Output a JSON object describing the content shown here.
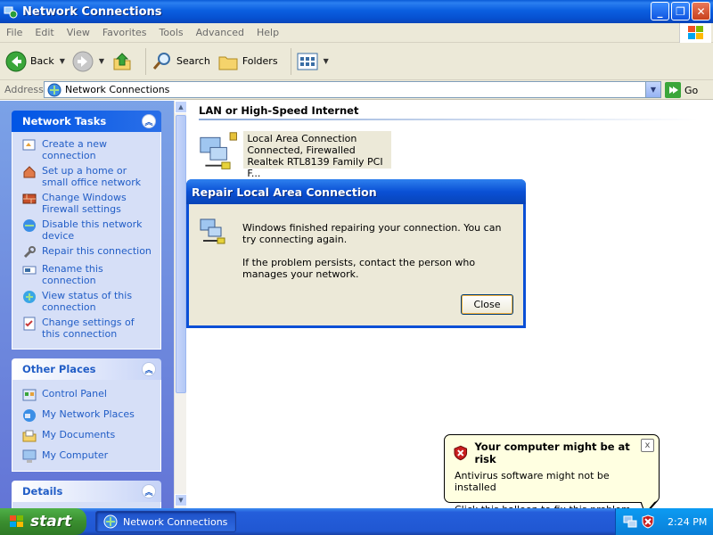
{
  "window": {
    "title": "Network Connections"
  },
  "menu": [
    "File",
    "Edit",
    "View",
    "Favorites",
    "Tools",
    "Advanced",
    "Help"
  ],
  "toolbar": {
    "back": "Back",
    "search": "Search",
    "folders": "Folders"
  },
  "address": {
    "label": "Address",
    "value": "Network Connections",
    "go": "Go"
  },
  "network_tasks": {
    "title": "Network Tasks",
    "items": [
      "Create a new connection",
      "Set up a home or small office network",
      "Change Windows Firewall settings",
      "Disable this network device",
      "Repair this connection",
      "Rename this connection",
      "View status of this connection",
      "Change settings of this connection"
    ]
  },
  "other_places": {
    "title": "Other Places",
    "items": [
      "Control Panel",
      "My Network Places",
      "My Documents",
      "My Computer"
    ]
  },
  "details": {
    "title": "Details"
  },
  "content": {
    "group": "LAN or High-Speed Internet",
    "connection": {
      "name": "Local Area Connection",
      "status": "Connected, Firewalled",
      "device": "Realtek RTL8139 Family PCI F..."
    }
  },
  "dialog": {
    "title": "Repair Local Area Connection",
    "line1": "Windows finished repairing your connection. You can try connecting again.",
    "line2": "If the problem persists, contact the person who manages your network.",
    "close": "Close"
  },
  "balloon": {
    "title": "Your computer might be at risk",
    "line1": "Antivirus software might not be installed",
    "line2": "Click this balloon to fix this problem.",
    "close": "x"
  },
  "taskbar": {
    "start": "start",
    "task": "Network Connections",
    "clock": "2:24 PM"
  },
  "colors": {
    "xp_blue": "#0a50d5",
    "task_link": "#215dc6",
    "panel_bg": "#d6dff7",
    "balloon_bg": "#ffffe1"
  }
}
